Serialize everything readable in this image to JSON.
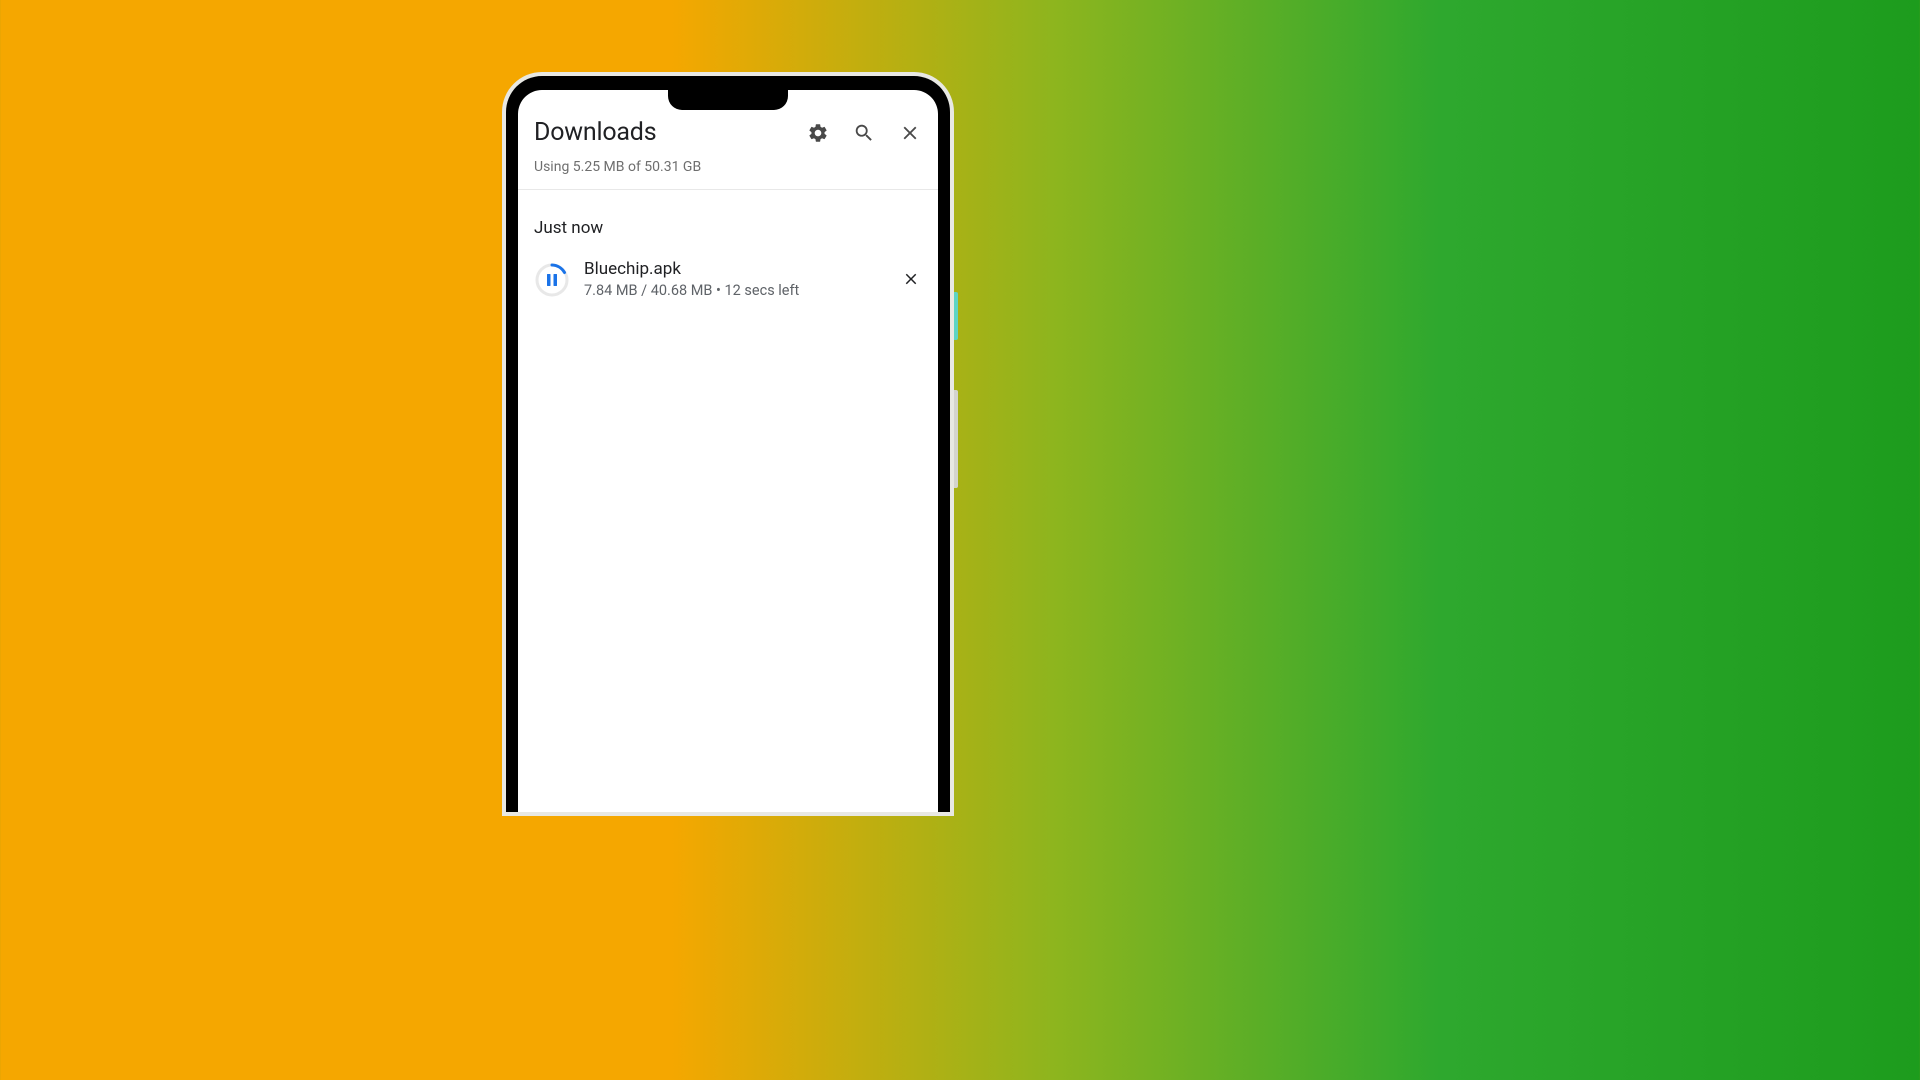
{
  "header": {
    "title": "Downloads",
    "storage_text": "Using 5.25 MB of 50.31 GB"
  },
  "section": {
    "label": "Just now"
  },
  "downloads": [
    {
      "filename": "Bluechip.apk",
      "progress": "7.84 MB / 40.68 MB • 12 secs left"
    }
  ]
}
